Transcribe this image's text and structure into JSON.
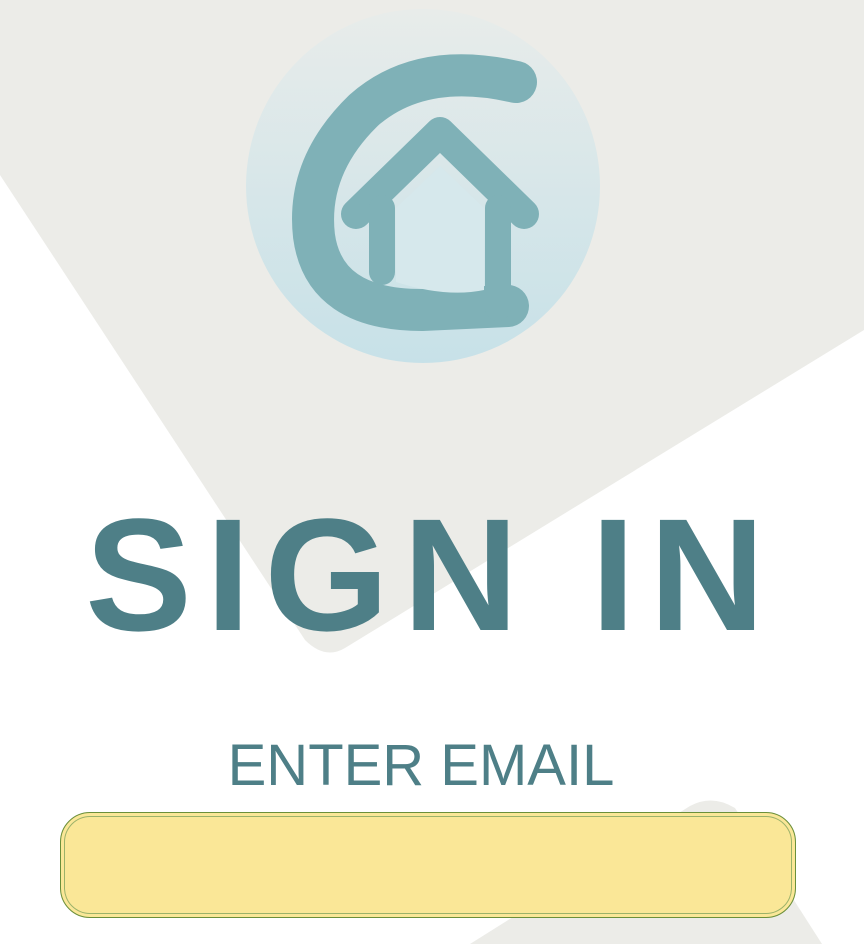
{
  "logo": {
    "name": "home-logo",
    "badge_color": "#d6e8ec",
    "mark_color": "#7fb1b7"
  },
  "heading": {
    "title": "SIGN IN"
  },
  "form": {
    "email_label": "ENTER EMAIL",
    "email_value": "",
    "email_placeholder": ""
  },
  "colors": {
    "accent": "#4e7f87",
    "input_fill": "#fae797",
    "background_shape": "#ecece8"
  }
}
